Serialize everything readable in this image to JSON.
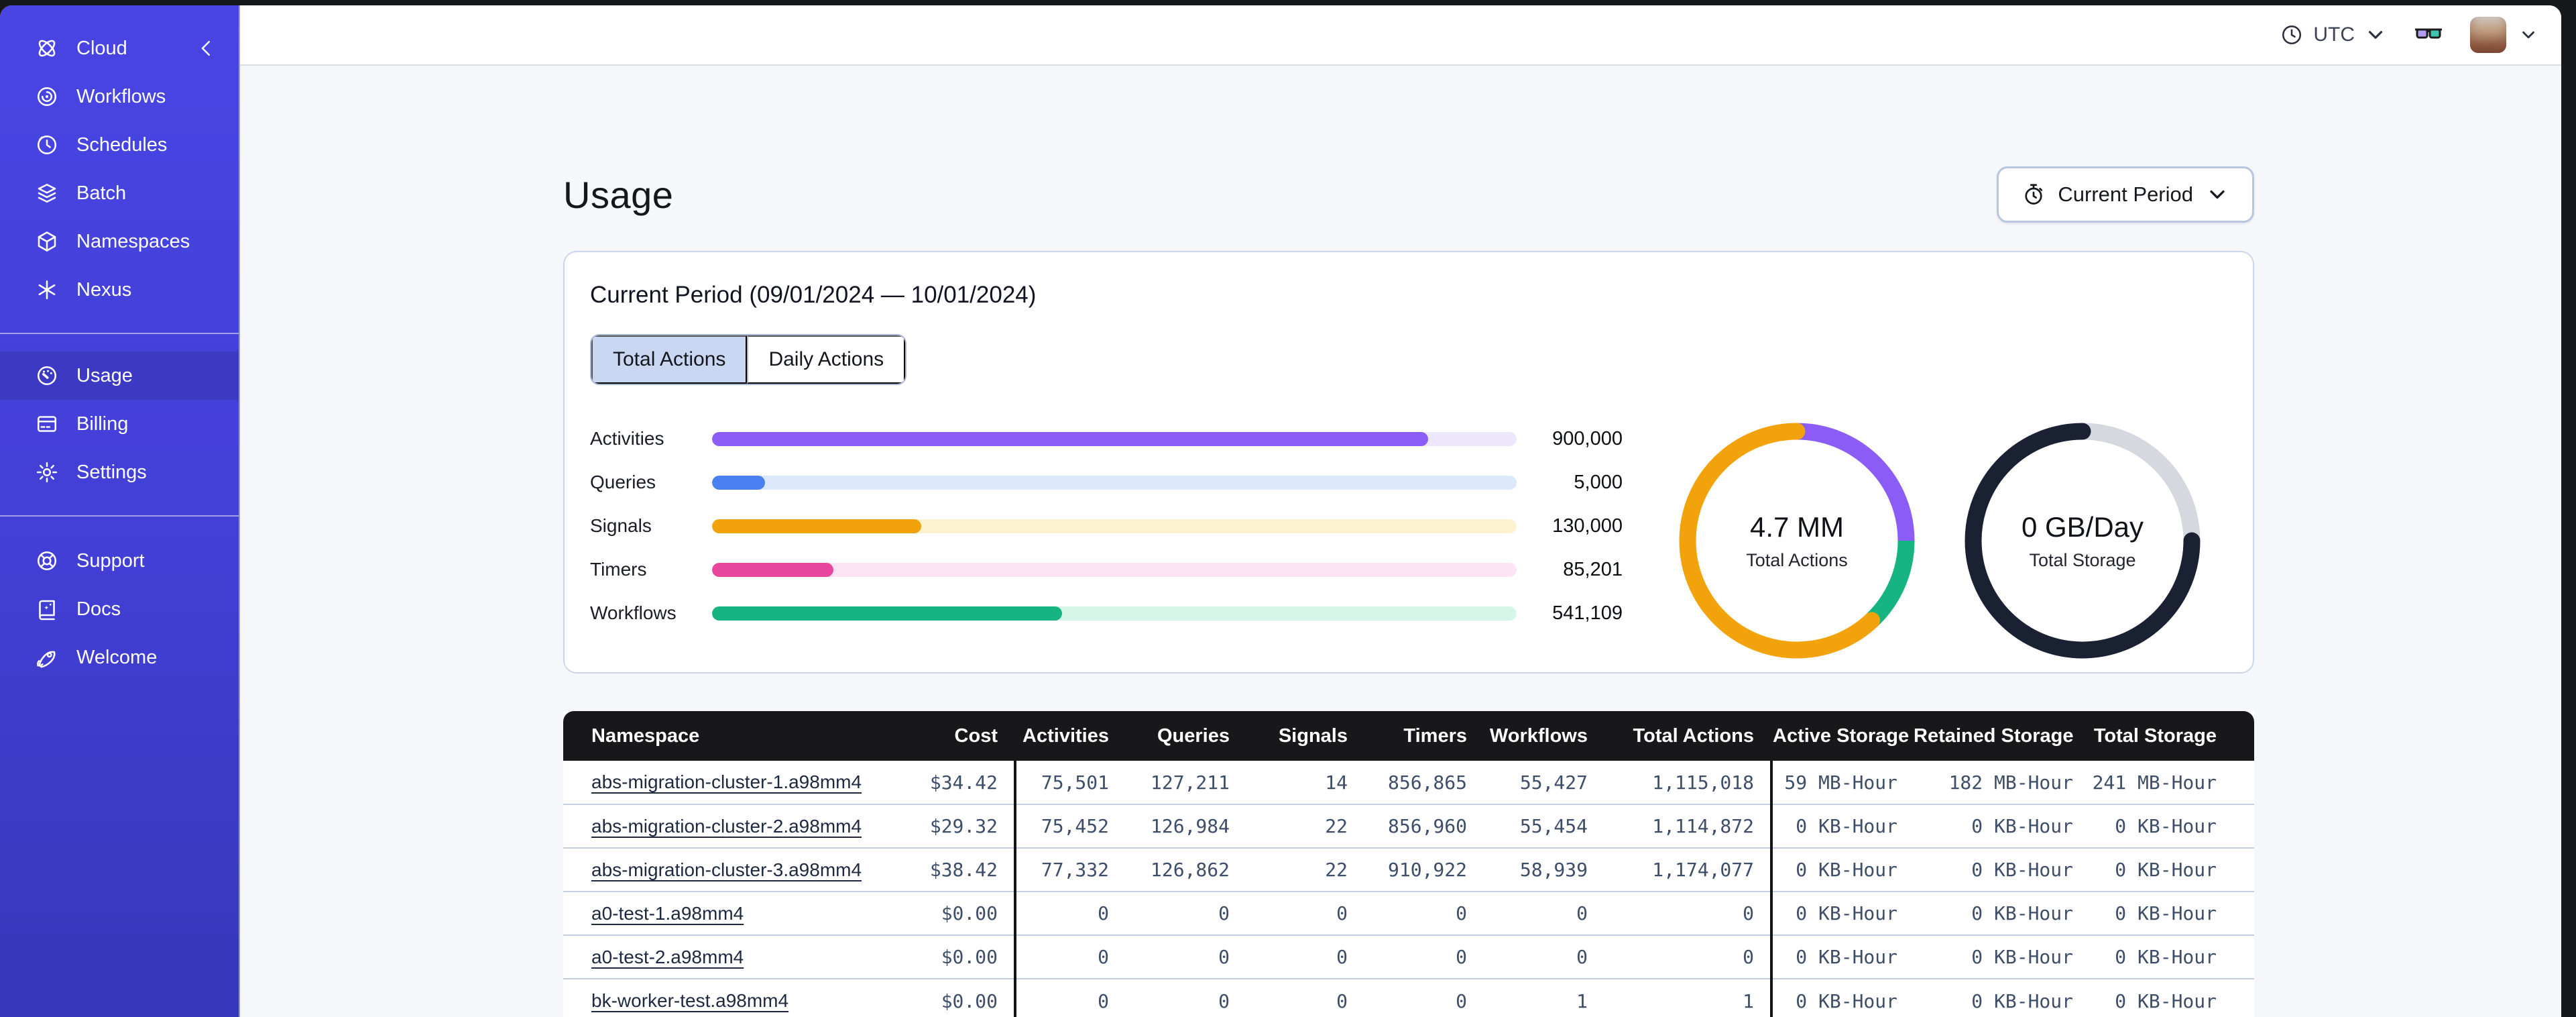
{
  "topbar": {
    "timezone": "UTC",
    "icons": [
      "clock-icon",
      "glasses-icon",
      "avatar",
      "chevron-down-icon"
    ]
  },
  "sidebar": {
    "brand": {
      "label": "Cloud",
      "icon": "temporal-logo-icon",
      "collapse_icon": "chevron-left-icon"
    },
    "groups": [
      {
        "items": [
          {
            "label": "Workflows",
            "icon": "workflows-icon"
          },
          {
            "label": "Schedules",
            "icon": "schedules-icon"
          },
          {
            "label": "Batch",
            "icon": "batch-icon"
          },
          {
            "label": "Namespaces",
            "icon": "namespaces-icon"
          },
          {
            "label": "Nexus",
            "icon": "nexus-icon"
          }
        ]
      },
      {
        "items": [
          {
            "label": "Usage",
            "icon": "usage-icon",
            "active": true
          },
          {
            "label": "Billing",
            "icon": "billing-icon"
          },
          {
            "label": "Settings",
            "icon": "settings-icon"
          }
        ]
      },
      {
        "items": [
          {
            "label": "Support",
            "icon": "support-icon"
          },
          {
            "label": "Docs",
            "icon": "docs-icon"
          },
          {
            "label": "Welcome",
            "icon": "welcome-icon"
          }
        ]
      }
    ]
  },
  "page": {
    "title": "Usage",
    "period_button": {
      "label": "Current Period",
      "icon": "stopwatch-icon"
    }
  },
  "card": {
    "title": "Current Period (09/01/2024 — 10/01/2024)",
    "tabs": [
      {
        "label": "Total Actions",
        "active": true
      },
      {
        "label": "Daily Actions",
        "active": false
      }
    ]
  },
  "chart_data": [
    {
      "type": "bar",
      "orientation": "horizontal",
      "categories": [
        "Activities",
        "Queries",
        "Signals",
        "Timers",
        "Workflows"
      ],
      "values": [
        900000,
        5000,
        130000,
        85201,
        541109
      ],
      "value_labels": [
        "900,000",
        "5,000",
        "130,000",
        "85,201",
        "541,109"
      ],
      "fill_fractions": [
        0.89,
        0.066,
        0.26,
        0.151,
        0.435
      ],
      "colors": [
        "#8b5cf6",
        "#4a80f0",
        "#f2a30b",
        "#e8459c",
        "#16b481"
      ],
      "track_colors": [
        "#ece7fc",
        "#dce8fc",
        "#fdf2cf",
        "#fce4f5",
        "#d7f6ea"
      ],
      "xlabel": "",
      "ylabel": "",
      "grid": false,
      "legend": false
    },
    {
      "type": "pie",
      "donut": true,
      "title": "4.7 MM",
      "subtitle": "Total Actions",
      "slices": [
        {
          "name": "purple-segment",
          "percent": 25,
          "color": "#8b5cf6"
        },
        {
          "name": "green-segment",
          "percent": 13,
          "color": "#16b481"
        },
        {
          "name": "orange-segment",
          "percent": 62,
          "color": "#f2a30b",
          "cap": "round"
        }
      ],
      "start_angle_deg": 0
    },
    {
      "type": "pie",
      "donut": true,
      "title": "0 GB/Day",
      "subtitle": "Total Storage",
      "slices": [
        {
          "name": "gray-segment",
          "percent": 25,
          "color": "#d5d8de"
        },
        {
          "name": "dark-segment",
          "percent": 75,
          "color": "#1a2133",
          "cap": "round"
        }
      ],
      "start_angle_deg": 0
    }
  ],
  "table": {
    "columns": [
      "Namespace",
      "Cost",
      "Activities",
      "Queries",
      "Signals",
      "Timers",
      "Workflows",
      "Total Actions",
      "Active Storage",
      "Retained Storage",
      "Total Storage"
    ],
    "divider_columns": [
      2,
      8
    ],
    "rows": [
      [
        "abs-migration-cluster-1.a98mm4",
        "$34.42",
        "75,501",
        "127,211",
        "14",
        "856,865",
        "55,427",
        "1,115,018",
        "59 MB-Hour",
        "182 MB-Hour",
        "241 MB-Hour"
      ],
      [
        "abs-migration-cluster-2.a98mm4",
        "$29.32",
        "75,452",
        "126,984",
        "22",
        "856,960",
        "55,454",
        "1,114,872",
        "0 KB-Hour",
        "0 KB-Hour",
        "0 KB-Hour"
      ],
      [
        "abs-migration-cluster-3.a98mm4",
        "$38.42",
        "77,332",
        "126,862",
        "22",
        "910,922",
        "58,939",
        "1,174,077",
        "0 KB-Hour",
        "0 KB-Hour",
        "0 KB-Hour"
      ],
      [
        "a0-test-1.a98mm4",
        "$0.00",
        "0",
        "0",
        "0",
        "0",
        "0",
        "0",
        "0 KB-Hour",
        "0 KB-Hour",
        "0 KB-Hour"
      ],
      [
        "a0-test-2.a98mm4",
        "$0.00",
        "0",
        "0",
        "0",
        "0",
        "0",
        "0",
        "0 KB-Hour",
        "0 KB-Hour",
        "0 KB-Hour"
      ],
      [
        "bk-worker-test.a98mm4",
        "$0.00",
        "0",
        "0",
        "0",
        "0",
        "1",
        "1",
        "0 KB-Hour",
        "0 KB-Hour",
        "0 KB-Hour"
      ]
    ]
  },
  "colors": {
    "sidebar_top": "#4845e3",
    "sidebar_bottom": "#3538b8",
    "sidebar_active": "#3c39c2",
    "page_bg": "#f5f7fa",
    "table_header_bg": "#18181b",
    "accent_tab_bg": "#c9d7f2"
  }
}
